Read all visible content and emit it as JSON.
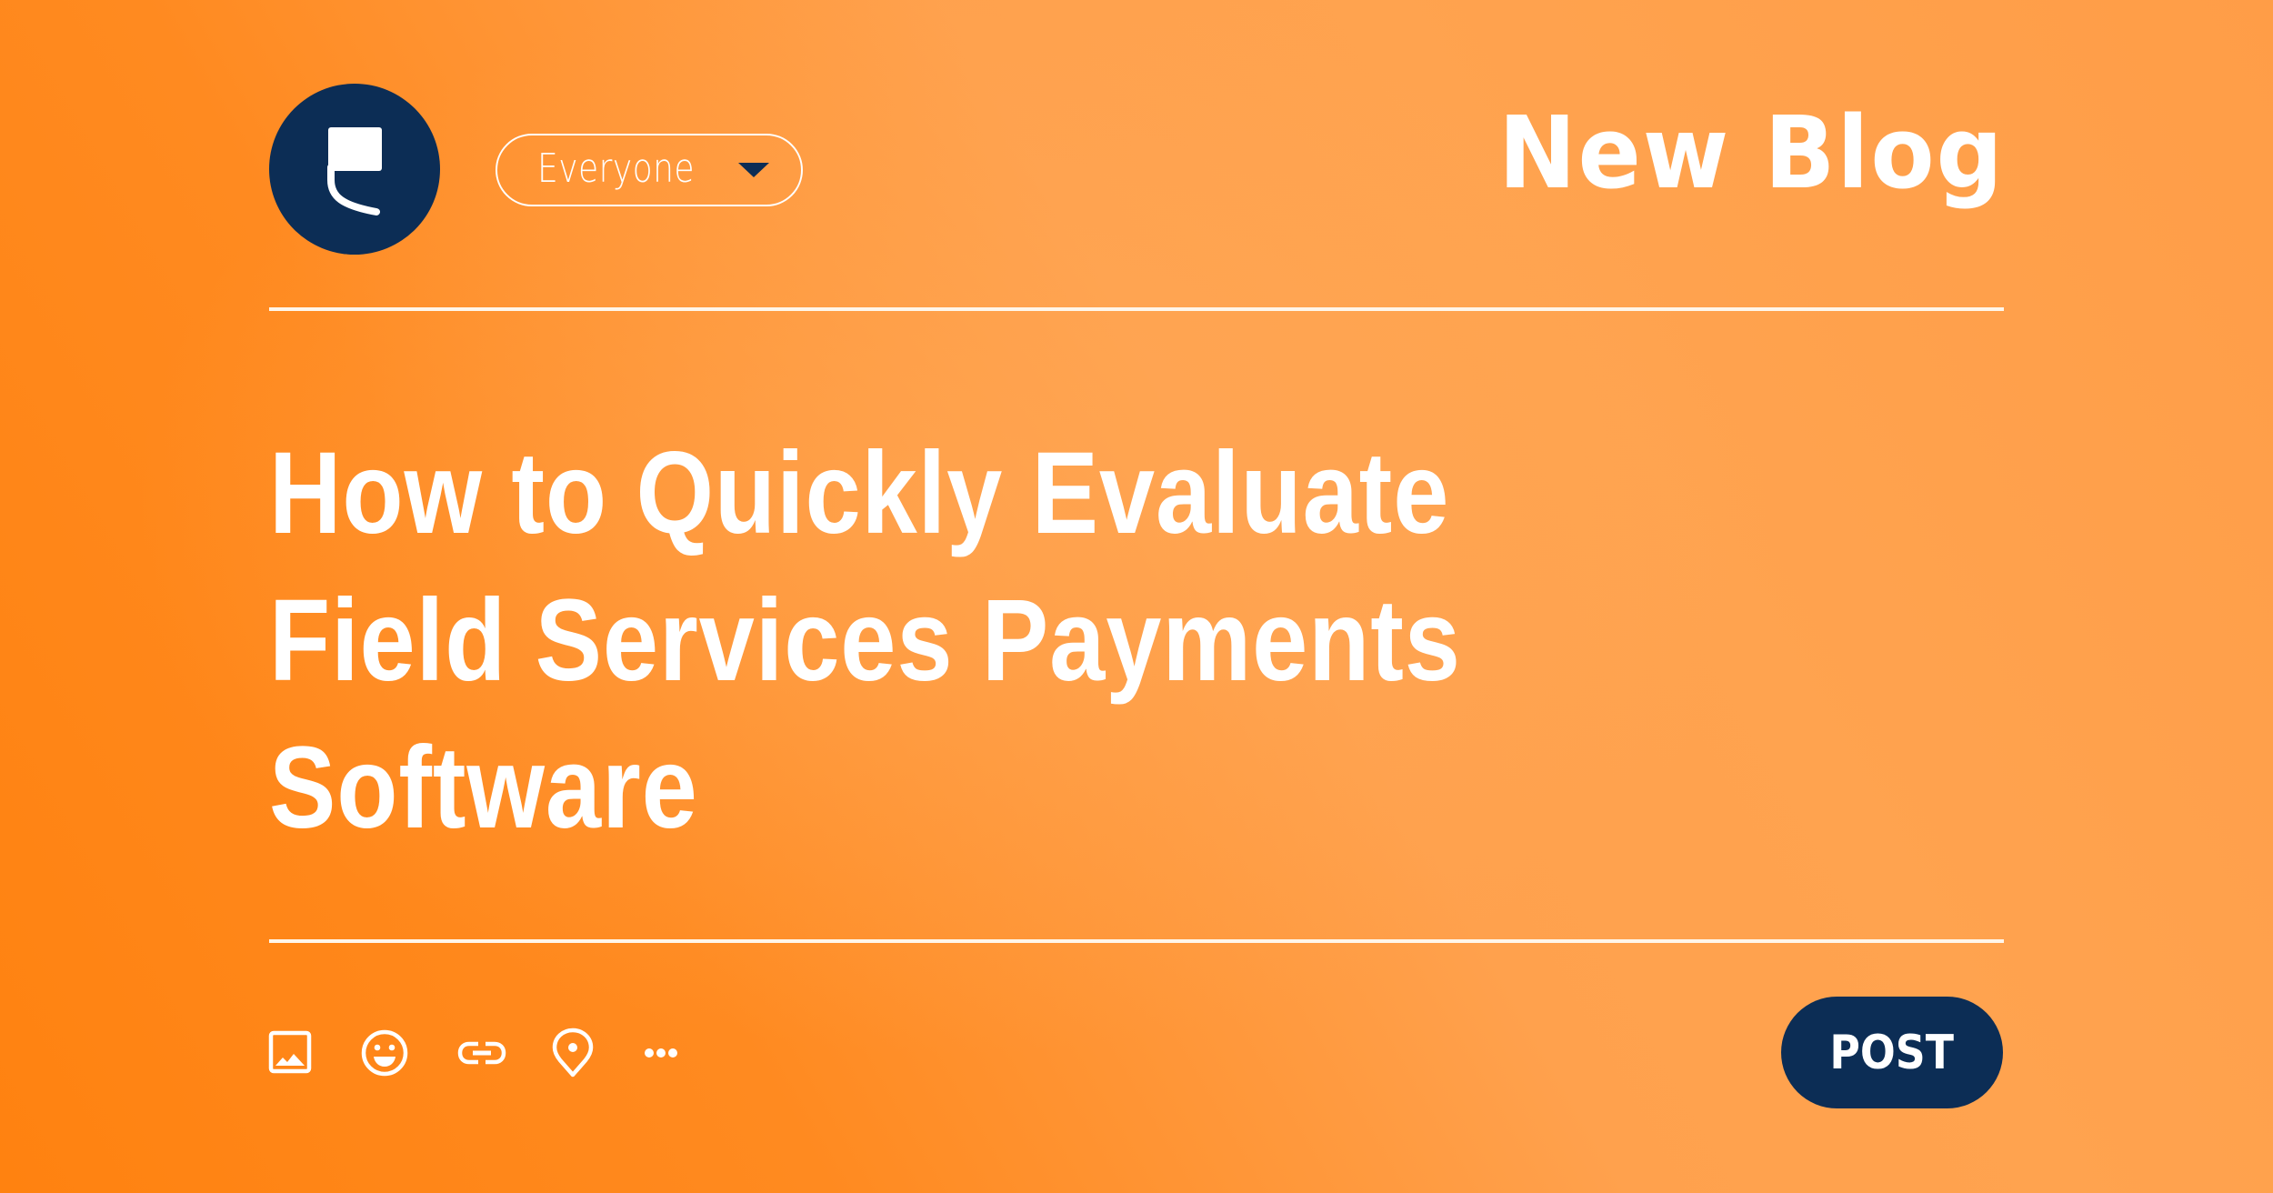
{
  "header": {
    "logo_icon": "speech-bubble-logo-icon",
    "audience_selector": {
      "selected": "Everyone",
      "caret_icon": "caret-down-icon"
    },
    "heading": "New Blog"
  },
  "post": {
    "title_lines": [
      "How to Quickly Evaluate",
      "Field Services Payments",
      "Software"
    ]
  },
  "toolbar": {
    "tools": [
      {
        "name": "image",
        "icon": "image-icon"
      },
      {
        "name": "emoji",
        "icon": "smiley-icon"
      },
      {
        "name": "link",
        "icon": "link-icon"
      },
      {
        "name": "location",
        "icon": "location-pin-icon"
      },
      {
        "name": "more",
        "icon": "more-dots-icon"
      }
    ],
    "post_label": "POST"
  },
  "colors": {
    "background_start": "#ff8210",
    "background_mid": "#ffa24e",
    "accent_navy": "#0c2d55",
    "foreground": "#ffffff"
  }
}
